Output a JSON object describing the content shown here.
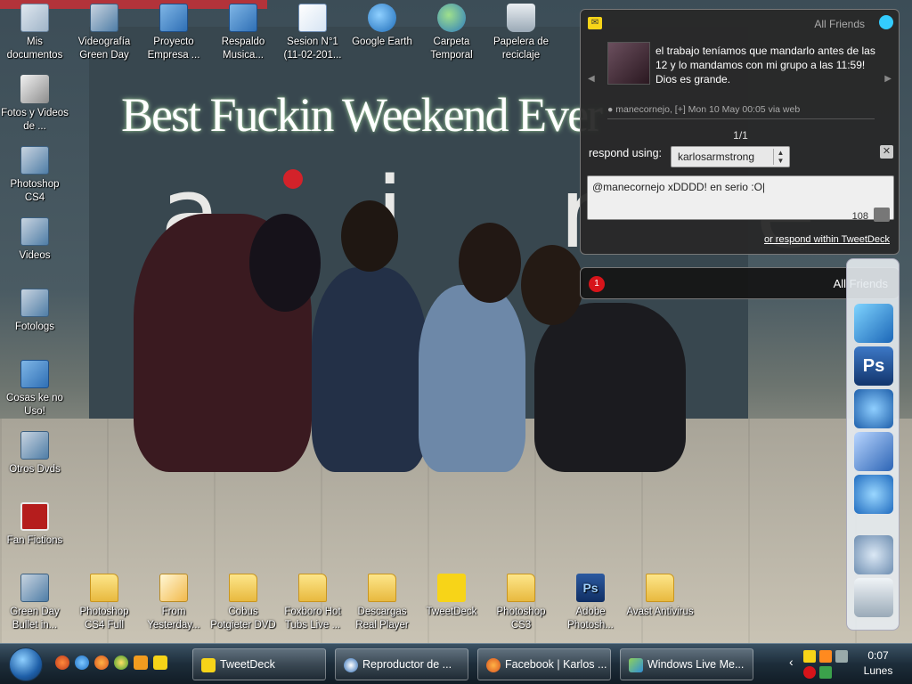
{
  "wallpaper": {
    "headline": "Best Fuckin Weekend Ever",
    "sign_text": "a i r e s"
  },
  "desktop_icons": [
    {
      "label": "Mis documentos",
      "icon": "documents-icon"
    },
    {
      "label": "Videografía Green Day",
      "icon": "video-folder-icon"
    },
    {
      "label": "Proyecto Empresa ...",
      "icon": "network-computer-icon"
    },
    {
      "label": "Respaldo Musica...",
      "icon": "network-computer-icon"
    },
    {
      "label": "Sesion N°1 (11-02-201...",
      "icon": "media-file-icon"
    },
    {
      "label": "Google Earth",
      "icon": "google-earth-icon"
    },
    {
      "label": "Carpeta Temporal",
      "icon": "globe-folder-icon"
    },
    {
      "label": "Papelera de reciclaje",
      "icon": "recycle-bin-icon"
    },
    {
      "label": "Fotos y Videos de ...",
      "icon": "camera-icon"
    },
    {
      "label": "Photoshop CS4",
      "icon": "video-folder-icon"
    },
    {
      "label": "Videos",
      "icon": "video-folder-icon"
    },
    {
      "label": "Fotologs",
      "icon": "video-folder-icon"
    },
    {
      "label": "Cosas ke no Uso!",
      "icon": "network-computer-icon"
    },
    {
      "label": "Otros Dvds",
      "icon": "video-folder-icon"
    },
    {
      "label": "Fan Fictions",
      "icon": "power-icon"
    },
    {
      "label": "Green Day Bullet in...",
      "icon": "video-folder-icon"
    },
    {
      "label": "Photoshop CS4 Full",
      "icon": "folder-icon"
    },
    {
      "label": "From Yesterday...",
      "icon": "media-file-icon"
    },
    {
      "label": "Cobus Potgieter DVD",
      "icon": "folder-icon"
    },
    {
      "label": "Foxboro Hot Tubs Live ...",
      "icon": "folder-icon"
    },
    {
      "label": "Descargas Real Player",
      "icon": "folder-icon"
    },
    {
      "label": "TweetDeck",
      "icon": "tweetdeck-icon"
    },
    {
      "label": "Photoshop CS3",
      "icon": "folder-icon"
    },
    {
      "label": "Adobe Photosh...",
      "icon": "photoshop-icon"
    },
    {
      "label": "Avast Antivirus",
      "icon": "folder-icon"
    }
  ],
  "tweetdeck": {
    "header_label": "All Friends",
    "tweet_text": "el trabajo teníamos que mandarlo antes de las 12 y lo mandamos con mi grupo a las 11:59! Dios es grande.",
    "meta": "● manecornejo, [+] Mon 10 May 00:05 via web",
    "counter": "1/1",
    "respond_label": "respond using:",
    "account": "karlosarmstrong",
    "reply_text": "@manecornejo xDDDD! en serio :O",
    "chars_left": "108",
    "within_link": "or respond within TweetDeck",
    "notify_count": "1",
    "notify_label": "All Friends",
    "colors": {
      "panel": "#282828",
      "badge": "#d7141a",
      "logo": "#f7d418"
    }
  },
  "taskbar": {
    "buttons": [
      {
        "label": "TweetDeck",
        "icon": "tweetdeck-icon"
      },
      {
        "label": "Reproductor de ...",
        "icon": "media-player-icon"
      },
      {
        "label": "Facebook | Karlos ...",
        "icon": "firefox-icon"
      },
      {
        "label": "Windows Live Me...",
        "icon": "messenger-icon"
      }
    ],
    "clock_time": "0:07",
    "clock_day": "Lunes"
  }
}
